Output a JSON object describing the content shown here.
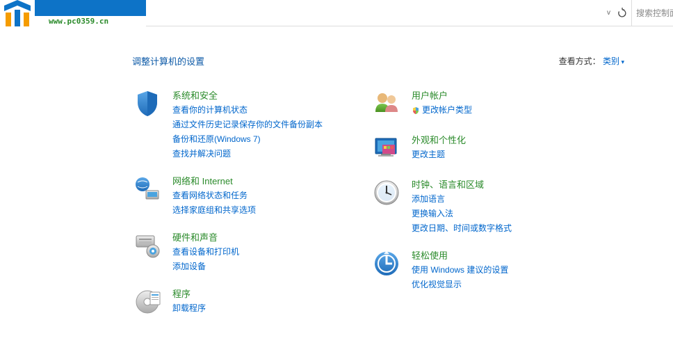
{
  "header": {
    "watermark": "www.pc0359.cn",
    "search_placeholder": "搜索控制面"
  },
  "page": {
    "title": "调整计算机的设置",
    "view_label": "查看方式：",
    "view_value": "类别"
  },
  "left_categories": [
    {
      "title": "系统和安全",
      "links": [
        "查看你的计算机状态",
        "通过文件历史记录保存你的文件备份副本",
        "备份和还原(Windows 7)",
        "查找并解决问题"
      ]
    },
    {
      "title": "网络和 Internet",
      "links": [
        "查看网络状态和任务",
        "选择家庭组和共享选项"
      ]
    },
    {
      "title": "硬件和声音",
      "links": [
        "查看设备和打印机",
        "添加设备"
      ]
    },
    {
      "title": "程序",
      "links": [
        "卸载程序"
      ]
    }
  ],
  "right_categories": [
    {
      "title": "用户帐户",
      "links": [
        "更改帐户类型"
      ],
      "shielded": [
        0
      ]
    },
    {
      "title": "外观和个性化",
      "links": [
        "更改主题"
      ]
    },
    {
      "title": "时钟、语言和区域",
      "links": [
        "添加语言",
        "更换输入法",
        "更改日期、时间或数字格式"
      ]
    },
    {
      "title": "轻松使用",
      "links": [
        "使用 Windows 建议的设置",
        "优化视觉显示"
      ]
    }
  ]
}
